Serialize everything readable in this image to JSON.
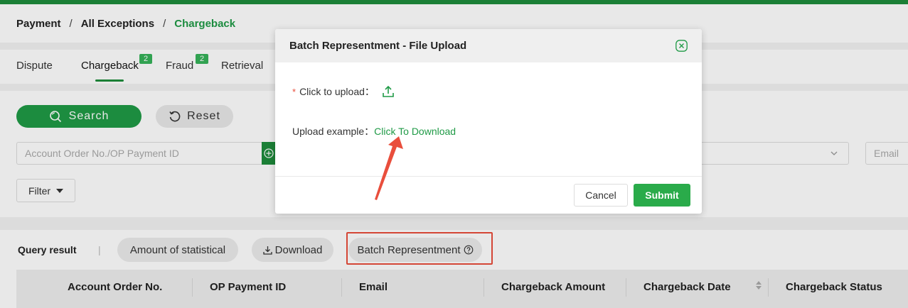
{
  "breadcrumb": {
    "items": [
      "Payment",
      "All Exceptions",
      "Chargeback"
    ],
    "separator": "/"
  },
  "tabs": [
    {
      "label": "Dispute"
    },
    {
      "label": "Chargeback",
      "badge": "2"
    },
    {
      "label": "Fraud",
      "badge": "2"
    },
    {
      "label": "Retrieval"
    }
  ],
  "filters": {
    "search_label": "Search",
    "reset_label": "Reset",
    "order_placeholder": "Account Order No./OP Payment ID",
    "email_placeholder": "Email",
    "filter_label": "Filter"
  },
  "results": {
    "label": "Query result",
    "separator": "|",
    "amount_label": "Amount of statistical",
    "download_label": "Download",
    "batch_label": "Batch Representment"
  },
  "table": {
    "columns": [
      "Account Order No.",
      "OP Payment ID",
      "Email",
      "Chargeback Amount",
      "Chargeback Date",
      "Chargeback Status"
    ]
  },
  "modal": {
    "title": "Batch Representment - File Upload",
    "required_mark": "*",
    "upload_label": "Click to upload：",
    "example_label": "Upload example：",
    "download_link": "Click To Download",
    "cancel_label": "Cancel",
    "submit_label": "Submit"
  },
  "colors": {
    "brand_green": "#1f9a46",
    "highlight_red": "#e94e3c"
  }
}
